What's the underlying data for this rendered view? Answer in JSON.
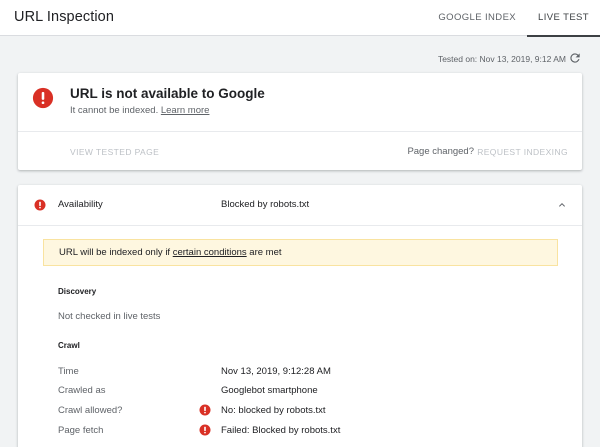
{
  "header": {
    "title": "URL Inspection",
    "tabs": [
      {
        "label": "GOOGLE INDEX",
        "active": false
      },
      {
        "label": "LIVE TEST",
        "active": true
      }
    ]
  },
  "tested_on": "Tested on: Nov 13, 2019, 9:12 AM",
  "status_card": {
    "title": "URL is not available to Google",
    "subtitle": "It cannot be indexed.",
    "learn_more": "Learn more",
    "view_tested_page": "VIEW TESTED PAGE",
    "page_changed": "Page changed?",
    "request_indexing": "REQUEST INDEXING"
  },
  "availability": {
    "label": "Availability",
    "value": "Blocked by robots.txt",
    "notice_prefix": "URL will be indexed only if",
    "notice_link": "certain conditions",
    "notice_suffix": "are met"
  },
  "discovery": {
    "heading": "Discovery",
    "text": "Not checked in live tests"
  },
  "crawl": {
    "heading": "Crawl",
    "rows": [
      {
        "label": "Time",
        "value": "Nov 13, 2019, 9:12:28 AM",
        "error": false
      },
      {
        "label": "Crawled as",
        "value": "Googlebot smartphone",
        "error": false
      },
      {
        "label": "Crawl allowed?",
        "value": "No: blocked by robots.txt",
        "error": true
      },
      {
        "label": "Page fetch",
        "value": "Failed: Blocked by robots.txt",
        "error": true
      }
    ]
  },
  "colors": {
    "error_red": "#d93025",
    "notice_bg": "#fef7e0",
    "accent": "#3c4043"
  },
  "icons": {
    "error": "error-circle-icon",
    "refresh": "refresh-icon",
    "collapse": "chevron-up-icon"
  }
}
